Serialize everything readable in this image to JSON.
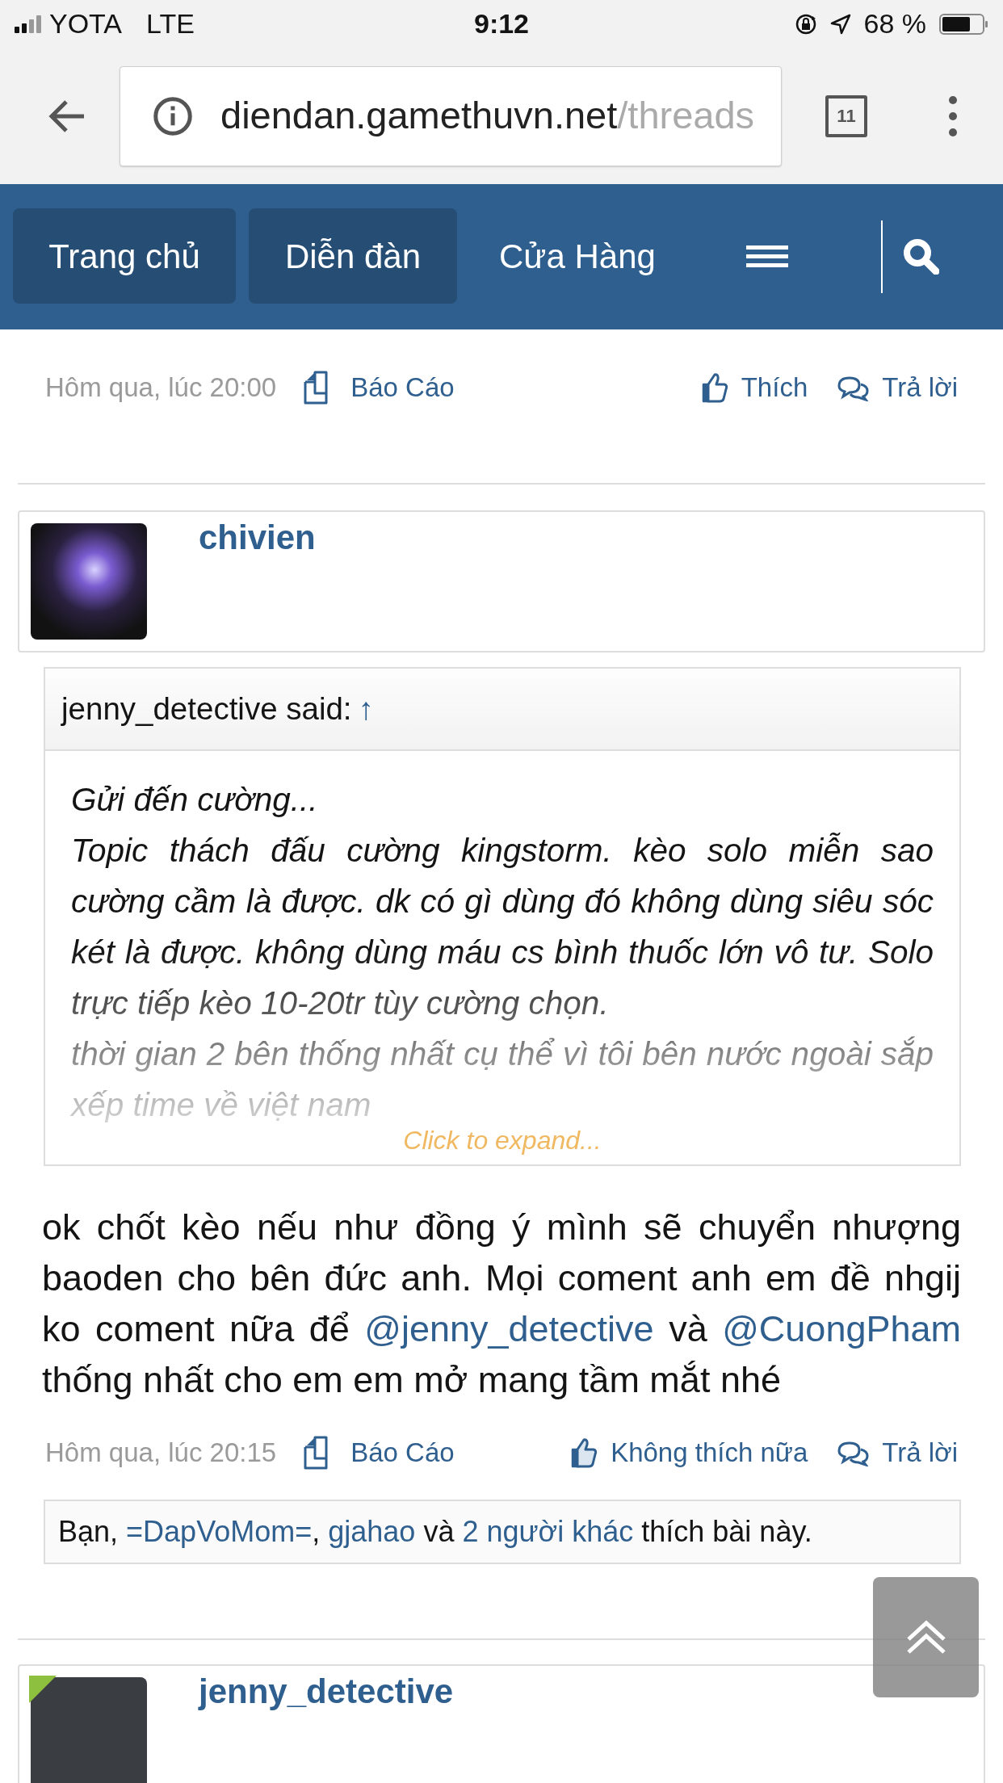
{
  "status_bar": {
    "carrier": "YOTA",
    "network": "LTE",
    "time": "9:12",
    "battery_text": "68 %"
  },
  "browser": {
    "url_host": "diendan.gamethuvn.net",
    "url_path": "/threads",
    "tab_count": "11"
  },
  "nav": {
    "items": [
      {
        "label": "Trang chủ",
        "selected": true
      },
      {
        "label": "Diễn đàn",
        "selected": true
      },
      {
        "label": "Cửa Hàng",
        "selected": false
      }
    ]
  },
  "posts": [
    {
      "kind": "footer_only",
      "footer": {
        "time": "Hôm qua, lúc 20:00",
        "report": "Báo Cáo",
        "like": "Thích",
        "liked": false,
        "reply": "Trả lời"
      }
    },
    {
      "kind": "full",
      "author": "chivien",
      "online": false,
      "quote": {
        "header": "jenny_detective said:",
        "arrow": "↑",
        "paragraphs": [
          "Gửi đến cường...",
          "Topic thách đấu cường kingstorm. kèo solo miễn sao cường cầm là được. dk có gì dùng đó không dùng siêu sóc két là được. không dùng máu cs bình thuốc lớn vô tư. Solo trực tiếp kèo 10-20tr tùy cường chọn.",
          "thời gian 2 bên thống nhất cụ thể vì tôi bên nước ngoài sắp xếp time về việt nam"
        ],
        "expand": "Click to expand..."
      },
      "body": [
        {
          "kind": "text",
          "text": "ok chốt kèo nếu như đồng ý mình sẽ chuyển nhượng baoden cho bên đức anh. Mọi coment anh em đề nhgij ko coment nữa để "
        },
        {
          "kind": "mention",
          "text": "@jenny_detective"
        },
        {
          "kind": "text",
          "text": " và "
        },
        {
          "kind": "mention",
          "text": "@CuongPham"
        },
        {
          "kind": "text",
          "text": " thống nhất cho em em mở mang tầm mắt nhé"
        }
      ],
      "footer": {
        "time": "Hôm qua, lúc 20:15",
        "report": "Báo Cáo",
        "like": "Không thích nữa",
        "liked": true,
        "reply": "Trả lời"
      },
      "likes": [
        {
          "kind": "text",
          "text": "Bạn,"
        },
        {
          "kind": "link",
          "text": "=DapVoMom=",
          "suffix": ","
        },
        {
          "kind": "link",
          "text": "gjahao"
        },
        {
          "kind": "text",
          "text": "và"
        },
        {
          "kind": "link",
          "text": "2 người khác"
        },
        {
          "kind": "text",
          "text": "thích bài này."
        }
      ]
    },
    {
      "kind": "header_only",
      "author": "jenny_detective",
      "online": true
    }
  ]
}
